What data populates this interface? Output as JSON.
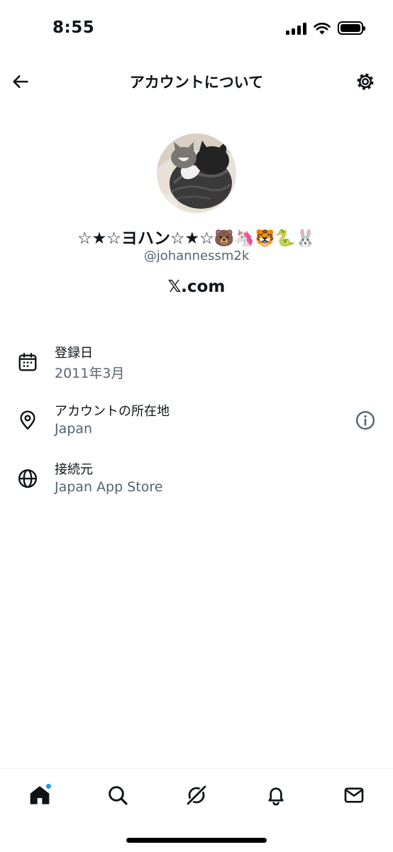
{
  "status_bar": {
    "time": "8:55"
  },
  "header": {
    "title": "アカウントについて"
  },
  "profile": {
    "display_name": "☆★☆ヨハン☆★☆🐻🦄🐯🐍🐰",
    "handle": "@johannessm2k",
    "website": "𝕏.com"
  },
  "info": {
    "joined": {
      "label": "登録日",
      "value": "2011年3月",
      "icon": "calendar-icon"
    },
    "location": {
      "label": "アカウントの所在地",
      "value": "Japan",
      "icon": "location-pin-icon"
    },
    "connected_via": {
      "label": "接続元",
      "value": "Japan App Store",
      "icon": "globe-icon"
    }
  },
  "tabs": [
    "home-icon",
    "search-icon",
    "grok-icon",
    "notifications-icon",
    "messages-icon"
  ],
  "colors": {
    "text_primary": "#0f1419",
    "text_secondary": "#536471",
    "accent": "#1d9bf0"
  }
}
